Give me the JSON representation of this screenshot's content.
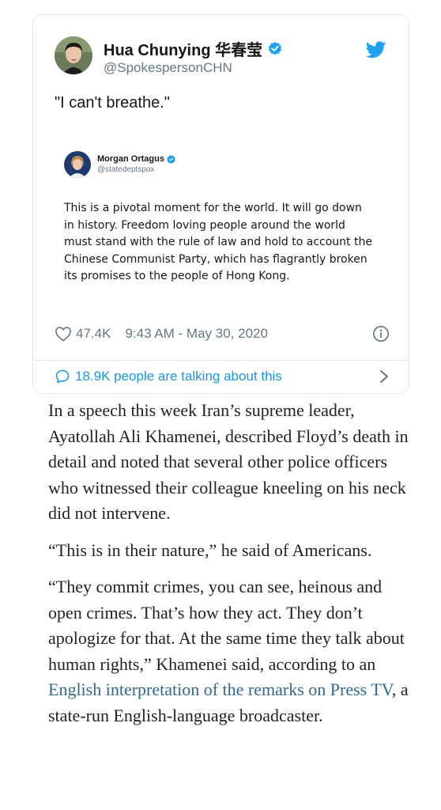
{
  "tweet": {
    "author_name": "Hua Chunying 华春莹",
    "author_handle": "@SpokespersonCHN",
    "text": "\"I can't breathe.\"",
    "like_count": "47.4K",
    "timestamp": "9:43 AM - May 30, 2020",
    "talking_text": "18.9K people are talking about this",
    "accent_color": "#1da1f2",
    "icons": [
      "verified-icon",
      "twitter-bird-icon",
      "heart-icon",
      "info-icon",
      "comment-icon",
      "chevron-right-icon"
    ]
  },
  "embedded": {
    "author_name": "Morgan Ortagus",
    "author_handle": "@statedeptspox",
    "lines": [
      "This is a pivotal moment for the world. It will go down",
      "in history. Freedom loving people around the world",
      "must stand with the rule of law and hold to account the",
      "Chinese Communist Party, which has flagrantly broken",
      "its promises to the people of Hong Kong."
    ]
  },
  "article": {
    "p1": "In a speech this week Iran’s supreme leader, Ayatollah Ali Khamenei, described Floyd’s death in detail and noted that several other police officers who witnessed their colleague kneeling on his neck did not intervene.",
    "p2": "“This is in their nature,” he said of Americans.",
    "p3_before": "“They commit crimes, you can see, heinous and open crimes. That’s how they act. They don’t apologize for that. At the same time they talk about human rights,” Khamenei said, according to an ",
    "p3_link": "English interpretation of the remarks on Press TV",
    "p3_after": ", a state-run English-language broadcaster.",
    "link_color": "#326891"
  }
}
